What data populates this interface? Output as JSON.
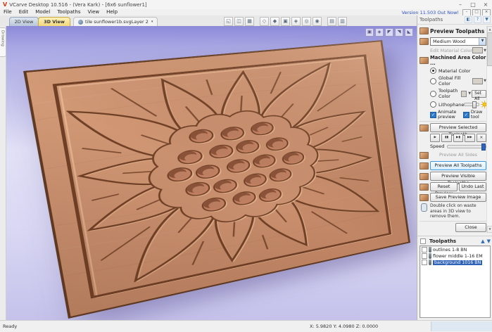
{
  "window": {
    "title": "VCarve Desktop 10.516 - (Vera Kark) - [6x6 sunflower1]",
    "minimize": "–",
    "maximize": "□",
    "close": "×"
  },
  "menu": {
    "items": [
      "File",
      "Edit",
      "Model",
      "Toolpaths",
      "View",
      "Help"
    ],
    "version_link": "Version 11.503 Out Now!",
    "mdi_minimize": "–",
    "mdi_restore": "□",
    "mdi_close": "×"
  },
  "tabs": {
    "view2d": "2D View",
    "view3d": "3D View",
    "file": "tile sunflower1b.svgLayer 2",
    "file_dropdown": "▾",
    "side": "Drawing"
  },
  "toolbar": {
    "icons": [
      {
        "name": "window-zoom-icon",
        "glyph": "◱"
      },
      {
        "name": "multi-view-icon",
        "glyph": "◫"
      },
      {
        "name": "grid-view-icon",
        "glyph": "▦"
      },
      {
        "name": "material-setup-icon",
        "glyph": "◇"
      },
      {
        "name": "lighting-icon",
        "glyph": "◆"
      },
      {
        "name": "toolpath-drawing-icon",
        "glyph": "▣"
      },
      {
        "name": "solid-preview-icon",
        "glyph": "◈"
      },
      {
        "name": "rotate-view-icon",
        "glyph": "◎"
      },
      {
        "name": "pan-view-icon",
        "glyph": "◉"
      },
      {
        "name": "split-horizontal-icon",
        "glyph": "▤"
      },
      {
        "name": "split-vertical-icon",
        "glyph": "▥"
      }
    ]
  },
  "viewport": {
    "icons": [
      {
        "name": "save-view-icon",
        "glyph": "▣"
      },
      {
        "name": "zoom-fit-icon",
        "glyph": "◈"
      },
      {
        "name": "iso-view-x-icon",
        "glyph": "◤"
      },
      {
        "name": "iso-view-y-icon",
        "glyph": "◥"
      },
      {
        "name": "iso-view-z-icon",
        "glyph": "◣"
      }
    ]
  },
  "preview_panel": {
    "caption": "Toolpaths",
    "caption_icons": {
      "dock": "◧",
      "help": "?",
      "pin": "▼"
    },
    "header": "Preview Toolpaths",
    "material_value": "Medium Wood",
    "edit_material_label": "Edit Material Color",
    "machined_heading": "Machined Area Color ...",
    "radio_material": "Material Color",
    "radio_global": "Global Fill Color",
    "radio_toolpath": "Toolpath Color",
    "radio_lithophane": "Lithophane",
    "set_all_label": "Set All",
    "animate_label": "Animate preview",
    "draw_tool_label": "Draw tool",
    "check_glyph": "✓",
    "preview_selected_label": "Preview Selected Toolpath",
    "playback": [
      "▶",
      "▮▮",
      "▶▮",
      "▶▶",
      "×"
    ],
    "speed_label": "Speed",
    "preview_all_sides_label": "Preview All Sides",
    "preview_all_label": "Preview All Toolpaths",
    "preview_visible_label": "Preview Visible Toolpaths",
    "reset_label": "Reset Preview",
    "undo_label": "Undo Last",
    "save_label": "Save Preview Image",
    "note": "Double click on waste areas in 3D view to remove them.",
    "close_label": "Close"
  },
  "toolpaths_panel": {
    "title": "Toolpaths",
    "up": "▲",
    "down": "▼",
    "items": [
      {
        "name": "outlines 1-8 BN",
        "selected": false
      },
      {
        "name": "flower middle 1-16 EM",
        "selected": false
      },
      {
        "name": "background 1016 BN",
        "selected": true
      }
    ]
  },
  "status": {
    "ready": "Ready",
    "coords": "X: 5.9820 Y: 4.0980 Z: 0.0000"
  },
  "colors": {
    "wood": "#c9906f",
    "groove": "#6f4026",
    "canvas_top": "#8c8ad8",
    "selection": "#2e63b8",
    "active_tab": "#f3d77e",
    "version_link": "#2b50c8"
  }
}
